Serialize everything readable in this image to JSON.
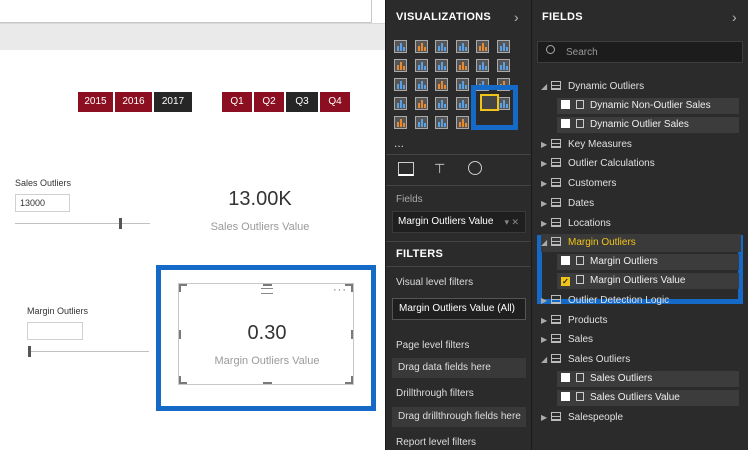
{
  "slicer_years": [
    "2015",
    "2016",
    "2017"
  ],
  "slicer_quarters": [
    "Q1",
    "Q2",
    "Q3",
    "Q4"
  ],
  "sales_outliers": {
    "label": "Sales Outliers",
    "input_value": "13000",
    "slider_position": 0.88
  },
  "sales_card": {
    "value": "13.00K",
    "caption": "Sales Outliers Value"
  },
  "margin_outliers": {
    "label": "Margin Outliers",
    "input_value": "",
    "slider_position": 0.0
  },
  "margin_card": {
    "value": "0.30",
    "caption": "Margin Outliers Value"
  },
  "visualizations": {
    "title": "VISUALIZATIONS",
    "more": "...",
    "fields_label": "Fields",
    "field_well_value": "Margin Outliers Value",
    "field_well_controls": "▾ ✕"
  },
  "filters": {
    "title": "FILTERS",
    "visual_level": "Visual level filters",
    "visual_item": "Margin Outliers Value (All)",
    "page_level": "Page level filters",
    "page_drop": "Drag data fields here",
    "drillthrough": "Drillthrough filters",
    "drill_drop": "Drag drillthrough fields here",
    "report_level": "Report level filters"
  },
  "fields_pane": {
    "title": "FIELDS",
    "search_placeholder": "Search",
    "tables": [
      {
        "name": "Dynamic Outliers",
        "expanded": true,
        "children": [
          "Dynamic Non-Outlier Sales",
          "Dynamic Outlier Sales"
        ]
      },
      {
        "name": "Key Measures",
        "expanded": false
      },
      {
        "name": "Outlier Calculations",
        "expanded": false
      },
      {
        "name": "Customers",
        "expanded": false
      },
      {
        "name": "Dates",
        "expanded": false
      },
      {
        "name": "Locations",
        "expanded": false
      },
      {
        "name": "Margin Outliers",
        "expanded": true,
        "highlight": true,
        "children": [
          "Margin Outliers",
          "Margin Outliers Value"
        ]
      },
      {
        "name": "Outlier Detection Logic",
        "expanded": false
      },
      {
        "name": "Products",
        "expanded": false
      },
      {
        "name": "Sales",
        "expanded": false
      },
      {
        "name": "Sales Outliers",
        "expanded": true,
        "children": [
          "Sales Outliers",
          "Sales Outliers Value"
        ]
      },
      {
        "name": "Salespeople",
        "expanded": false
      }
    ],
    "checked_field": "Margin Outliers Value"
  },
  "colors": {
    "accent": "#1569c7",
    "slicer_red": "#8b0f20",
    "slicer_selected": "#262626",
    "highlight_text": "#f0c419"
  }
}
